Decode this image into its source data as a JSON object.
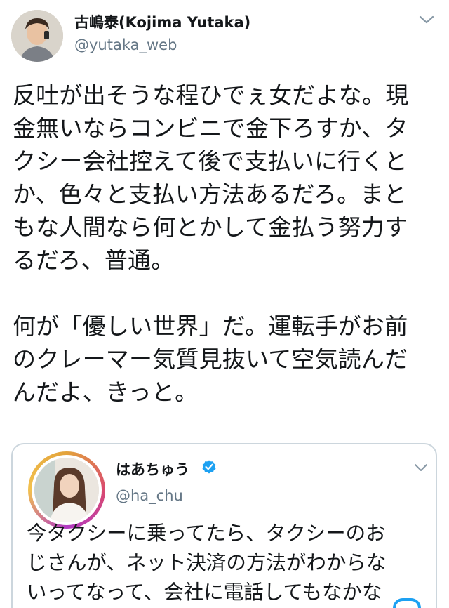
{
  "tweet": {
    "author_name": "古嶋泰(Kojima Yutaka)",
    "author_handle": "@yutaka_web",
    "menu_icon": "chevron-down-icon",
    "body_lines": [
      "反吐が出そうな程ひでぇ女だよな。現",
      "金無いならコンビニで金下ろすか、タ",
      "クシー会社控えて後で支払いに行くと",
      "か、色々と支払い方法あるだろ。まと",
      "もな人間なら何とかして金払う努力す",
      "るだろ、普通。",
      "",
      "何が「優しい世界」だ。運転手がお前",
      "のクレーマー気質見抜いて空気読んだ",
      "んだよ、きっと。"
    ]
  },
  "quoted_tweet": {
    "author_name": "はあちゅう",
    "verified_icon": "verified-badge-icon",
    "author_handle": "@ha_chu",
    "menu_icon": "chevron-down-icon",
    "body_lines": [
      "今タクシーに乗ってたら、タクシーのお",
      "じさんが、ネット決済の方法がわからな",
      "いってなって、会社に電話してもなかな"
    ]
  },
  "colors": {
    "text": "#14171a",
    "secondary": "#657786",
    "border": "#ccd6dd",
    "verified": "#1da1f2"
  }
}
